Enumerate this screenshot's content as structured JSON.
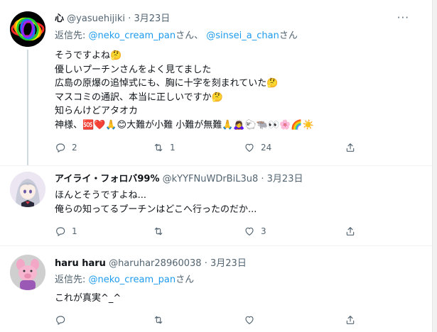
{
  "tweets": [
    {
      "name": "心",
      "handle": "@yasuehijiki",
      "separator": "·",
      "date": "3月23日",
      "reply_prefix": "返信先:",
      "reply_user1": "@neko_cream_pan",
      "reply_suffix1": "さん、",
      "reply_user2": "@sinsei_a_chan",
      "reply_suffix2": "さん",
      "lines": [
        "そうですよね🤔",
        "優しいプーチンさんをよく見てました",
        "広島の原爆の追悼式にも、胸に十字を刻まれていた🤔",
        "マスコミの通訳、本当に正しいですか🤔",
        "知らんけどアタオカ",
        "神様、🆘❤️🙏😊大難が小難 小難が無難🙏🙇‍♀️🐑🐃👀🌸🌈☀️"
      ],
      "replies": "2",
      "retweets": "1",
      "likes": "24"
    },
    {
      "name": "アイライ・フォロバ99%",
      "handle": "@kYYFNuWDrBiL3u8",
      "separator": "·",
      "date": "3月23日",
      "lines": [
        "ほんとそうですよね...",
        "俺らの知ってるプーチンはどこへ行ったのだか..."
      ],
      "replies": "1",
      "retweets": "",
      "likes": "3"
    },
    {
      "name": "haru haru",
      "handle": "@haruhar28960038",
      "separator": "·",
      "date": "3月23日",
      "reply_prefix": "返信先:",
      "reply_user1": "@neko_cream_pan",
      "reply_suffix1": "さん",
      "lines": [
        "これが真実^_^"
      ],
      "replies": "",
      "retweets": "",
      "likes": ""
    }
  ],
  "more_label": "···",
  "colors": {
    "link": "#1d9bf0",
    "muted": "#536471",
    "divider": "#eff3f4"
  }
}
